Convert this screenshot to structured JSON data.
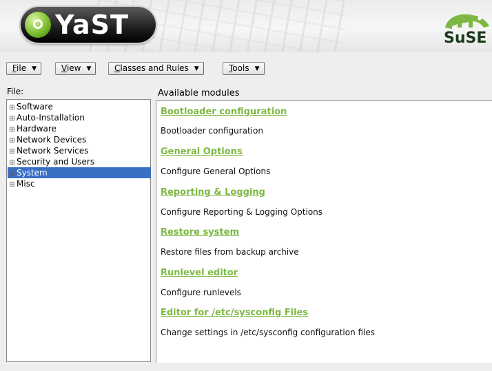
{
  "banner": {
    "logo_text": "YaST",
    "vendor_text": "SuSE"
  },
  "menubar": [
    {
      "mnemonic": "F",
      "rest": "ile"
    },
    {
      "mnemonic": "V",
      "rest": "iew"
    },
    {
      "mnemonic": "C",
      "rest": "lasses and Rules"
    },
    {
      "mnemonic": "T",
      "rest": "ools"
    }
  ],
  "file_panel": {
    "label": "File:"
  },
  "tree": [
    {
      "label": "Software",
      "selected": false
    },
    {
      "label": "Auto-Installation",
      "selected": false
    },
    {
      "label": "Hardware",
      "selected": false
    },
    {
      "label": "Network Devices",
      "selected": false
    },
    {
      "label": "Network Services",
      "selected": false
    },
    {
      "label": "Security and Users",
      "selected": false
    },
    {
      "label": "System",
      "selected": true
    },
    {
      "label": "Misc",
      "selected": false
    }
  ],
  "modules_panel": {
    "label": "Available modules",
    "modules": [
      {
        "title": "Bootloader configuration",
        "description": "Bootloader configuration"
      },
      {
        "title": "General Options",
        "description": "Configure General Options"
      },
      {
        "title": "Reporting & Logging",
        "description": "Configure Reporting & Logging Options"
      },
      {
        "title": "Restore system",
        "description": "Restore files from backup archive"
      },
      {
        "title": "Runlevel editor",
        "description": "Configure runlevels"
      },
      {
        "title": "Editor for /etc/sysconfig Files",
        "description": "Change settings in /etc/sysconfig configuration files"
      }
    ]
  },
  "colors": {
    "link": "#7db843",
    "selection": "#3a6fc4",
    "background": "#eeeeee"
  }
}
